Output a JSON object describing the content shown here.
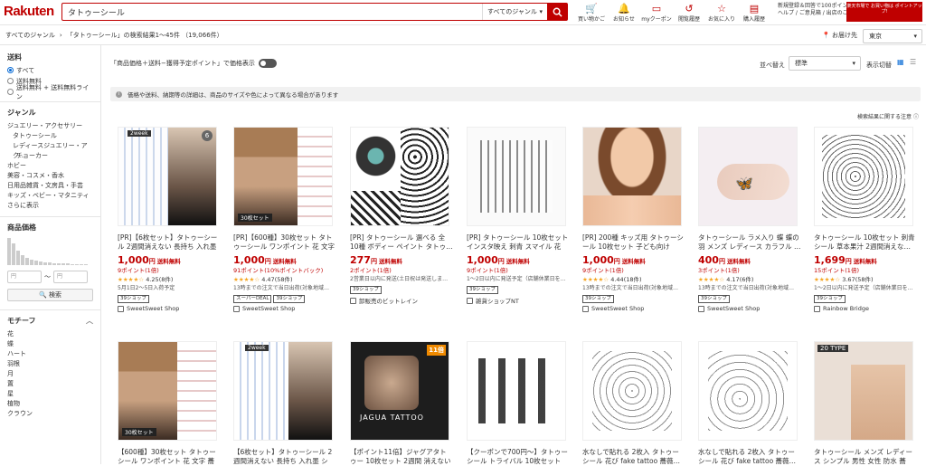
{
  "header": {
    "logo": "Rakuten",
    "search_value": "タトゥーシール",
    "genre": "すべてのジャンル",
    "nav": [
      {
        "label": "買い物かご",
        "icon": "cart-icon"
      },
      {
        "label": "お知らせ",
        "icon": "bell-icon"
      },
      {
        "label": "myクーポン",
        "icon": "coupon-icon"
      },
      {
        "label": "閲覧履歴",
        "icon": "history-icon"
      },
      {
        "label": "お気に入り",
        "icon": "star-icon"
      },
      {
        "label": "購入履歴",
        "icon": "receipt-icon"
      }
    ],
    "promo_line1": "新規登録＆回答で100ポイント!",
    "promo_line2": "ヘルプ / ご意見箱 / 出店のご案内",
    "banner": "楽天市場で お買い物は ポイントアップ!"
  },
  "breadcrumb": {
    "all": "すべてのジャンル",
    "text": "「タトゥーシール」の検索結果1〜45件 （19,066件）",
    "deliver_label": "お届け先",
    "location": "東京"
  },
  "sidebar": {
    "shipping_title": "送料",
    "shipping_options": [
      "すべて",
      "送料無料",
      "送料無料 + 送料無料ライン"
    ],
    "genre_title": "ジャンル",
    "genres": [
      "ジュエリー・アクセサリー",
      "タトゥーシール",
      "レディースジュエリー・アク…",
      "チョーカー",
      "ホビー",
      "美容・コスメ・香水",
      "日用品雑貨・文房具・手芸",
      "キッズ・ベビー・マタニティ",
      "さらに表示"
    ],
    "price_title": "商品価格",
    "price_min": "円",
    "price_max": "円",
    "search_btn": "検索",
    "motif_title": "モチーフ",
    "motifs": [
      "花",
      "蝶",
      "ハート",
      "羽根",
      "月",
      "置",
      "星",
      "植物",
      "クラウン"
    ]
  },
  "toolbar": {
    "toggle_label": "「商品価格＋送料−獲得予定ポイント」で価格表示",
    "sort_label": "並べ替え",
    "sort_value": "標準",
    "view_label": "表示切替"
  },
  "notice": "価格や送料、納期等の詳細は、商品のサイズや色によって異なる場合があります",
  "sort_note": "検索結果に関する注意",
  "products": [
    {
      "title": "[PR]【6枚セット】タトゥーシール 2週間消えない 長持ち 入れ墨 …",
      "price": "1,000",
      "points": "9ポイント(1倍)",
      "rating": "4.25",
      "reviews": "(8件)",
      "ship": "5月1日2〜5日入荷予定",
      "tag": "39ショップ",
      "shop": "SweetSweet Shop"
    },
    {
      "title": "[PR]【600種】30枚セット タトゥーシール ワンポイント 花 文字 …",
      "price": "1,000",
      "points": "91ポイント(10%ポイントバック)",
      "rating": "4.47",
      "reviews": "(58件)",
      "ship": "13時までの注文で当日出荷(対象地域…",
      "tag": "スーパーDEAL",
      "tag2": "39ショップ",
      "shop": "SweetSweet Shop"
    },
    {
      "title": "[PR] タトゥーシール 選べる 全10種 ボディー ペイント タトゥ…",
      "price": "277",
      "points": "2ポイント(1倍)",
      "rating": "",
      "reviews": "",
      "ship": "2営業日以内に発送(土日祝は発送しま…",
      "tag": "39ショップ",
      "shop": "卸販売のビットレイン"
    },
    {
      "title": "[PR] タトゥーシール 10枚セット インスタ映え 刺青 スマイル 花 …",
      "price": "1,000",
      "points": "9ポイント(1倍)",
      "rating": "",
      "reviews": "",
      "ship": "1〜2日以内に発送予定（店舗休業日を…",
      "tag": "39ショップ",
      "shop": "雑貨ショップNT"
    },
    {
      "title": "[PR] 200種 キッズ用 タトゥーシール 10枚セット 子ども向け カ…",
      "price": "1,000",
      "points": "9ポイント(1倍)",
      "rating": "4.44",
      "reviews": "(18件)",
      "ship": "13時までの注文で当日出荷(対象地域…",
      "tag": "39ショップ",
      "shop": "SweetSweet Shop"
    },
    {
      "title": "タトゥーシール ラメ入り 蝶 蝶の羽 メンズ レディース カラフル …",
      "price": "400",
      "points": "3ポイント(1倍)",
      "rating": "4.17",
      "reviews": "(6件)",
      "ship": "13時までの注文で当日出荷(対象地域…",
      "tag": "39ショップ",
      "shop": "SweetSweet Shop"
    },
    {
      "title": "タトゥーシール 10枚セット 刺青シール 草本果汁 2週間消えな…",
      "price": "1,699",
      "points": "15ポイント(1倍)",
      "rating": "3.67",
      "reviews": "(58件)",
      "ship": "1〜2日以内に発送予定（店舗休業日を…",
      "tag": "39ショップ",
      "shop": "Rainbow Bridge"
    },
    {
      "title": "【600種】30枚セット タトゥーシール ワンポイント 花 文字 蕎薇…"
    },
    {
      "title": "【6枚セット】タトゥーシール 2週間消えない 長持ち 入れ墨 シー…"
    },
    {
      "title": "【ポイント11倍】ジャグアタトゥー 10枚セット 2週間 消えない ジ…"
    },
    {
      "title": "【クーポンで700円〜】タトゥーシール トライバル 10枚セット(…"
    },
    {
      "title": "水なしで貼れる 2枚入 タトゥーシール 花び fake tattoo 蕎薇…"
    },
    {
      "title": "水なしで貼れる 2枚入 タトゥーシール 花び fake tattoo 蕎薇…"
    },
    {
      "title": "タトゥーシール メンズ レディース シンプル 男性 女性 防水 蕎薇…"
    }
  ],
  "yen": "円",
  "free_ship": "送料無料",
  "overlays": {
    "p1": "2week",
    "p1b": "6",
    "p2": "30枚セット",
    "p8": "30枚セット",
    "p9": "2week",
    "p10": "JAGUA TATTOO",
    "p10b": "11倍",
    "p12": "20 TYPE"
  }
}
